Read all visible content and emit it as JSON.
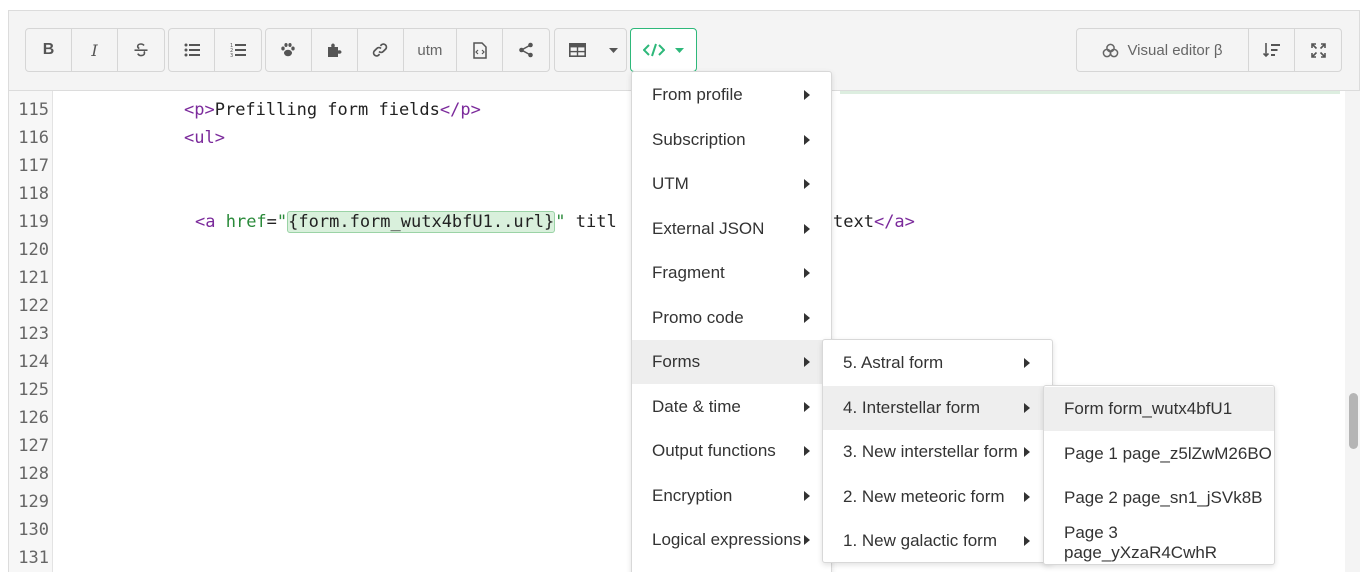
{
  "toolbar": {
    "groups": [
      {
        "name": "format",
        "buttons": [
          {
            "icon": "bold-icon",
            "label": "B"
          },
          {
            "icon": "italic-icon",
            "label": "I"
          },
          {
            "icon": "strikethrough-icon",
            "label": ""
          }
        ]
      },
      {
        "name": "lists",
        "buttons": [
          {
            "icon": "bullet-list-icon"
          },
          {
            "icon": "numbered-list-icon"
          }
        ]
      },
      {
        "name": "insert",
        "buttons": [
          {
            "icon": "paw-icon"
          },
          {
            "icon": "puzzle-icon"
          },
          {
            "icon": "link-icon"
          },
          {
            "label": "utm"
          },
          {
            "icon": "file-code-icon"
          },
          {
            "icon": "share-icon"
          }
        ]
      },
      {
        "name": "table",
        "buttons": [
          {
            "icon": "table-icon"
          },
          {
            "icon": "caret-down-icon"
          }
        ]
      }
    ],
    "code_button": {
      "icon": "code-icon",
      "accent": "#2eb87a"
    },
    "visual_editor_label": "Visual editor β",
    "utm_label": "utm"
  },
  "editor": {
    "lines": [
      {
        "n": "115",
        "parts": [
          [
            "tag",
            "<p>"
          ],
          [
            "txt",
            "Prefilling form fields"
          ],
          [
            "tag",
            "</p>"
          ]
        ]
      },
      {
        "n": "116",
        "parts": [
          [
            "tag",
            "<ul>"
          ]
        ]
      },
      {
        "n": "117",
        "parts": []
      },
      {
        "n": "118",
        "parts": []
      },
      {
        "n": "119",
        "parts": [
          [
            "tag",
            "<a "
          ],
          [
            "attr",
            "href"
          ],
          [
            "txt",
            "="
          ],
          [
            "str",
            "\""
          ],
          [
            "hl",
            "{form.form_wutx4bfU1..url}"
          ],
          [
            "str",
            "\""
          ],
          [
            "txt",
            " titl"
          ]
        ]
      },
      {
        "n": "120",
        "parts": []
      },
      {
        "n": "121",
        "parts": []
      },
      {
        "n": "122",
        "parts": []
      },
      {
        "n": "123",
        "parts": []
      },
      {
        "n": "124",
        "parts": []
      },
      {
        "n": "125",
        "parts": []
      },
      {
        "n": "126",
        "parts": []
      },
      {
        "n": "127",
        "parts": []
      },
      {
        "n": "128",
        "parts": []
      },
      {
        "n": "129",
        "parts": []
      },
      {
        "n": "130",
        "parts": []
      },
      {
        "n": "131",
        "parts": []
      }
    ],
    "line119_tail": [
      "text",
      "</a>"
    ]
  },
  "menu": {
    "items": [
      "From profile",
      "Subscription",
      "UTM",
      "External JSON",
      "Fragment",
      "Promo code",
      "Forms",
      "Date & time",
      "Output functions",
      "Encryption",
      "Logical expressions"
    ],
    "active": "Forms"
  },
  "forms_submenu": {
    "items": [
      "5. Astral form",
      "4. Interstellar form",
      "3. New interstellar form",
      "2. New meteoric form",
      "1. New galactic form"
    ],
    "active": "4. Interstellar form"
  },
  "interstellar_submenu": {
    "items": [
      "Form form_wutx4bfU1",
      "Page 1 page_z5lZwM26BO",
      "Page 2 page_sn1_jSVk8B",
      "Page 3 page_yXzaR4CwhR"
    ],
    "active": "Form form_wutx4bfU1"
  }
}
